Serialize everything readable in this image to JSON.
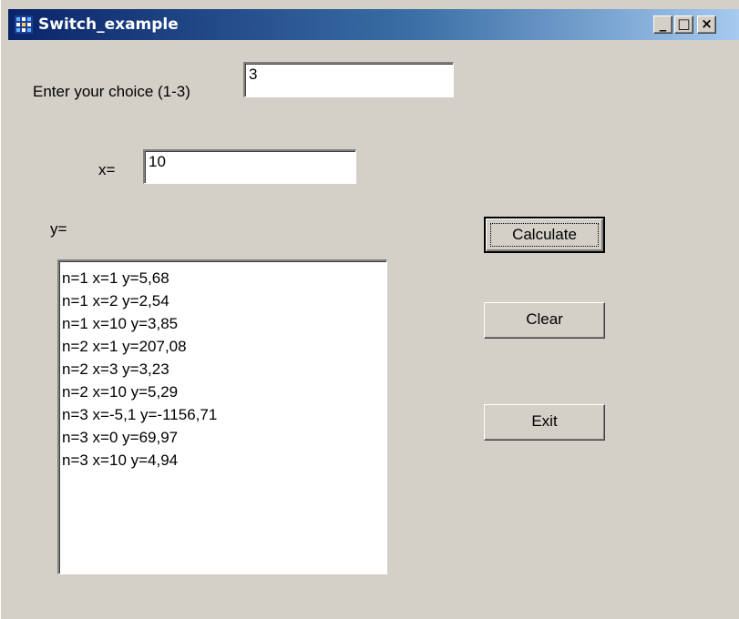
{
  "window": {
    "title": "Switch_example",
    "minimize_glyph": "_",
    "maximize_glyph": "□",
    "close_glyph": "×"
  },
  "form": {
    "choice_label": "Enter your choice (1-3)",
    "choice_value": "3",
    "x_label": "x=",
    "x_value": "10",
    "y_label": "y="
  },
  "results": [
    "n=1 x=1 y=5,68",
    "n=1 x=2 y=2,54",
    "n=1 x=10 y=3,85",
    "n=2 x=1 y=207,08",
    "n=2 x=3 y=3,23",
    "n=2 x=10 y=5,29",
    "n=3 x=-5,1 y=-1156,71",
    "n=3 x=0 y=69,97",
    "n=3 x=10 y=4,94"
  ],
  "buttons": {
    "calculate": "Calculate",
    "clear": "Clear",
    "exit": "Exit"
  },
  "icons": {
    "app": "app-icon"
  },
  "colors": {
    "face": "#d4d0c8",
    "title_start": "#0a246a",
    "title_end": "#a6caf0"
  }
}
